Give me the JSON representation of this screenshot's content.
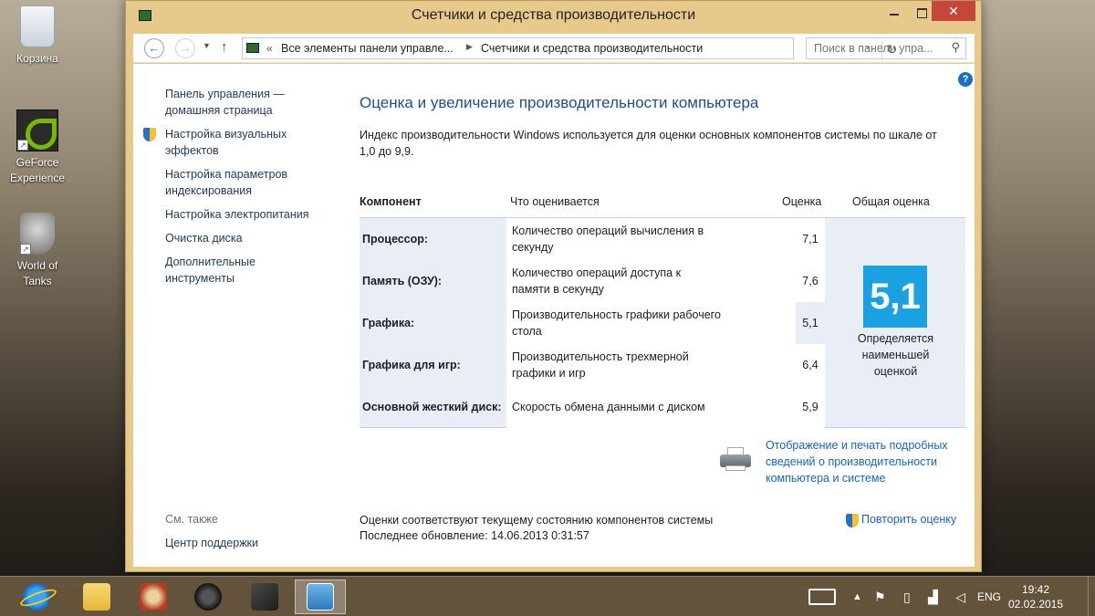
{
  "desktop": {
    "icons": [
      {
        "label": "Корзина"
      },
      {
        "label": "GeForce Experience"
      },
      {
        "label": "World of Tanks"
      }
    ]
  },
  "window": {
    "title": "Счетчики и средства производительности",
    "close_label": "✕"
  },
  "address": {
    "crumb_root": "Все элементы панели управле...",
    "crumb_current": "Счетчики и средства производительности",
    "search_placeholder": "Поиск в панели упра..."
  },
  "sidebar": {
    "items": [
      {
        "label": "Панель управления — домашняя страница"
      },
      {
        "label": "Настройка визуальных эффектов"
      },
      {
        "label": "Настройка параметров индексирования"
      },
      {
        "label": "Настройка электропитания"
      },
      {
        "label": "Очистка диска"
      },
      {
        "label": "Дополнительные инструменты"
      }
    ],
    "see_also": "См. также",
    "support": "Центр поддержки"
  },
  "main": {
    "heading": "Оценка и увеличение производительности компьютера",
    "intro": "Индекс производительности Windows используется для оценки основных компонентов системы по шкале от 1,0 до 9,9.",
    "columns": {
      "component": "Компонент",
      "rated": "Что оценивается",
      "score": "Оценка",
      "total": "Общая оценка"
    },
    "rows": [
      {
        "component": "Процессор:",
        "rated": "Количество операций вычисления в секунду",
        "score": "7,1"
      },
      {
        "component": "Память (ОЗУ):",
        "rated": "Количество операций доступа к памяти в секунду",
        "score": "7,6"
      },
      {
        "component": "Графика:",
        "rated": "Производительность графики рабочего стола",
        "score": "5,1"
      },
      {
        "component": "Графика для игр:",
        "rated": "Производительность трехмерной графики и игр",
        "score": "6,4"
      },
      {
        "component": "Основной жесткий диск:",
        "rated": "Скорость обмена данными с диском",
        "score": "5,9"
      }
    ],
    "total_score": "5,1",
    "total_caption": "Определяется наименьшей оценкой",
    "print_link": "Отображение и печать подробных сведений о производительности компьютера и системе",
    "status_line1": "Оценки соответствуют текущему состоянию компонентов системы",
    "status_line2": "Последнее обновление: 14.06.2013 0:31:57",
    "rerun": "Повторить оценку"
  },
  "taskbar": {
    "lang": "ENG",
    "time": "19:42",
    "date": "02.02.2015"
  },
  "colors": {
    "accent": "#1ba1e2",
    "link": "#1a66b8",
    "heading": "#1f4f88",
    "frame": "#e8c98c"
  }
}
